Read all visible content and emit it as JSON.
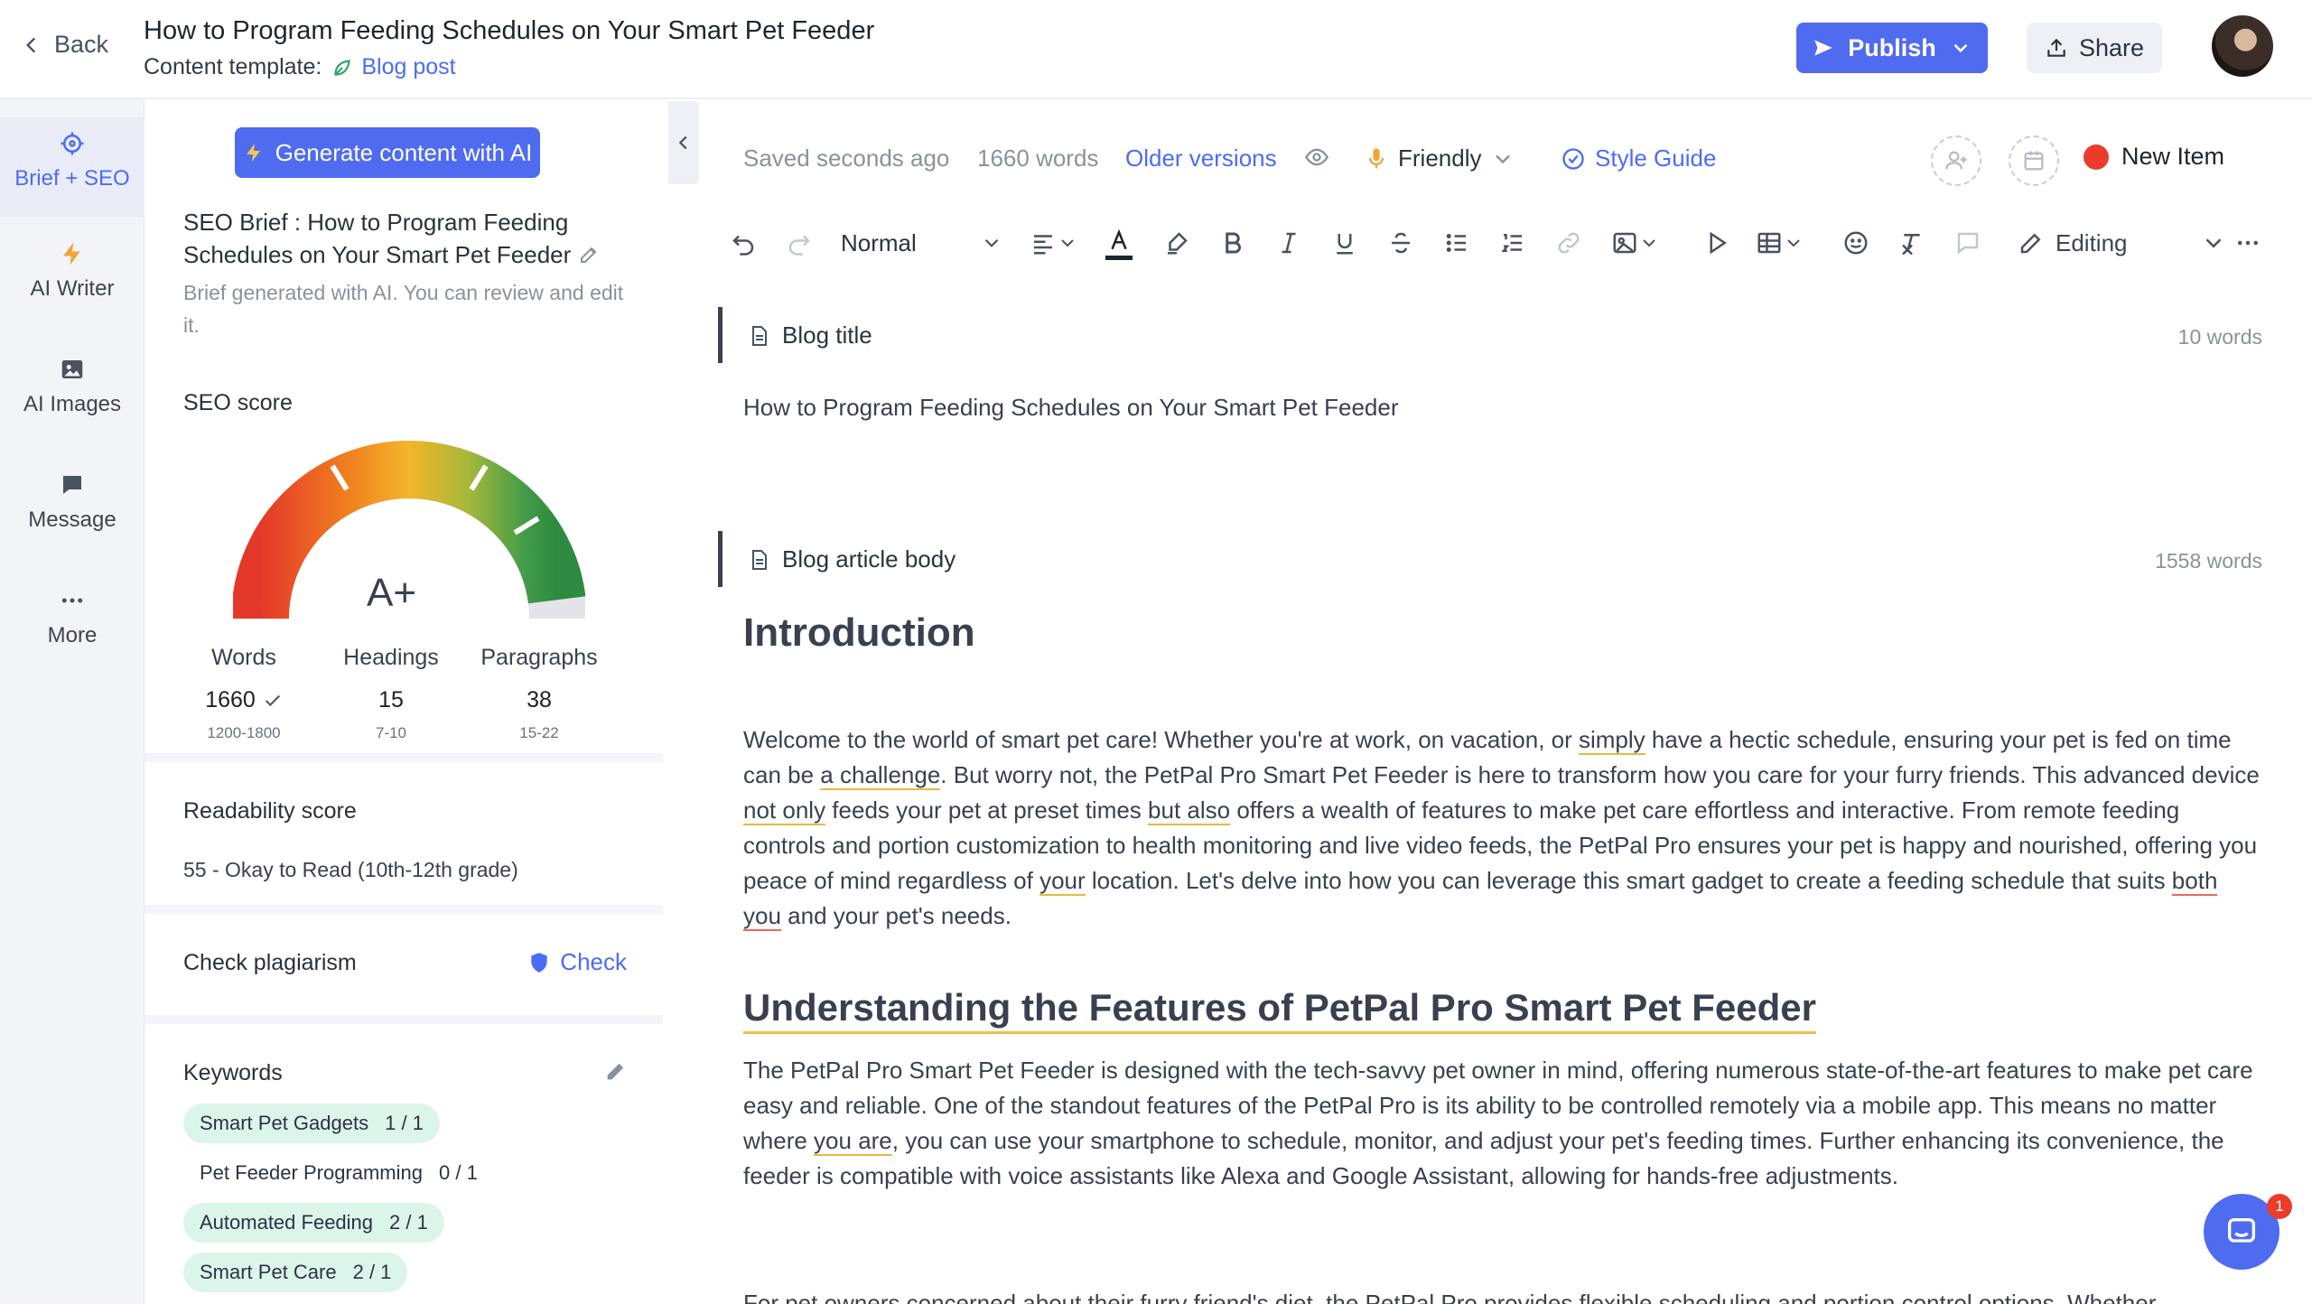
{
  "header": {
    "back_label": "Back",
    "title": "How to Program Feeding Schedules on Your Smart Pet Feeder",
    "template_prefix": "Content template:",
    "template_name": "Blog post",
    "publish_label": "Publish",
    "share_label": "Share"
  },
  "leftnav": [
    {
      "label": "Brief + SEO",
      "icon": "crosshair-icon"
    },
    {
      "label": "AI Writer",
      "icon": "bolt-icon"
    },
    {
      "label": "AI Images",
      "icon": "image-icon"
    },
    {
      "label": "Message",
      "icon": "chat-icon"
    },
    {
      "label": "More",
      "icon": "ellipsis-icon"
    }
  ],
  "brief": {
    "generate_label": "Generate content with AI",
    "title": "SEO Brief : How to Program Feeding Schedules on Your Smart Pet Feeder",
    "subtitle": "Brief generated with AI. You can review and edit it.",
    "seo_label": "SEO score",
    "grade": "A+",
    "gauge_fraction": 0.96,
    "metrics": [
      {
        "label": "Words",
        "value": "1660",
        "range": "1200-1800",
        "check": true
      },
      {
        "label": "Headings",
        "value": "15",
        "range": "7-10",
        "check": false
      },
      {
        "label": "Paragraphs",
        "value": "38",
        "range": "15-22",
        "check": false
      }
    ],
    "readability_label": "Readability score",
    "readability_value": "55 - Okay to Read (10th-12th grade)",
    "plagiarism_label": "Check plagiarism",
    "check_label": "Check",
    "keywords_label": "Keywords",
    "keywords": [
      {
        "name": "Smart Pet Gadgets",
        "count": "1 / 1",
        "done": true
      },
      {
        "name": "Pet Feeder Programming",
        "count": "0 / 1",
        "done": false
      },
      {
        "name": "Automated Feeding",
        "count": "2 / 1",
        "done": true
      },
      {
        "name": "Smart Pet Care",
        "count": "2 / 1",
        "done": true
      }
    ]
  },
  "status": {
    "saved": "Saved seconds ago",
    "words": "1660 words",
    "older_versions": "Older versions",
    "tone": "Friendly",
    "style_guide": "Style Guide",
    "new_item": "New Item"
  },
  "toolbar": {
    "style": "Normal",
    "mode": "Editing"
  },
  "blocks": {
    "title_label": "Blog title",
    "title_count": "10 words",
    "title_text": "How to Program Feeding Schedules on Your Smart Pet Feeder",
    "body_label": "Blog article body",
    "body_count": "1558 words"
  },
  "article": {
    "h_intro": "Introduction",
    "p1_a": "Welcome to the world of smart pet care! Whether you're at work, on vacation, or ",
    "p1_u1": "simply",
    "p1_b": " have a hectic schedule, ensuring your pet is fed on time can be ",
    "p1_u2": "a challenge",
    "p1_c": ". But worry not, the PetPal Pro Smart Pet Feeder is here to transform how you care for your furry friends. This advanced device ",
    "p1_u3": "not only",
    "p1_d": " feeds your pet at preset times ",
    "p1_u4": "but also",
    "p1_e": " offers a wealth of features to make pet care effortless and interactive. From remote feeding controls and portion customization to health monitoring and live video feeds, the PetPal Pro ensures your pet is happy and nourished, offering you peace of mind regardless of ",
    "p1_u5": "your",
    "p1_f": " location. Let's delve into how you can leverage this smart gadget to create a feeding schedule that suits ",
    "p1_u6": "both you",
    "p1_g": " and your pet's needs.",
    "h_features": "Understanding the Features of PetPal Pro Smart Pet Feeder",
    "p2_a": "The PetPal Pro Smart Pet Feeder is designed with the tech-savvy pet owner in mind, offering numerous state-of-the-art features to make pet care easy and reliable. One of the standout features of the PetPal Pro is its ability to be controlled remotely via a mobile app. This means no matter where ",
    "p2_u1": "you are",
    "p2_b": ", you can use your smartphone to schedule, monitor, and adjust your pet's feeding times. Further enhancing its convenience, the feeder is compatible with voice assistants like Alexa and Google Assistant, allowing for hands-free adjustments.",
    "p3": "For pet owners concerned about their furry friend's diet, the PetPal Pro provides flexible scheduling and portion control options. Whether"
  },
  "chat": {
    "badge": "1"
  },
  "colors": {
    "accent": "#4f6bf0",
    "keyword_done": "#dcf5ea",
    "alert": "#ea3b2b"
  }
}
